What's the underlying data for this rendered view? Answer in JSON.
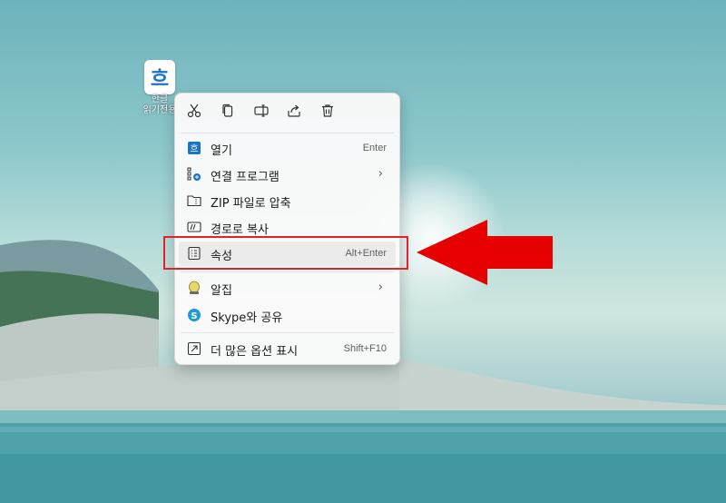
{
  "desktop": {
    "icon_label_line1": "한글",
    "icon_label_line2": "읽기전용",
    "icon_glyph": "흐",
    "icon_name": "hwp-document-icon"
  },
  "context_menu": {
    "toolbar": [
      {
        "icon": "cut-icon"
      },
      {
        "icon": "copy-icon"
      },
      {
        "icon": "rename-icon"
      },
      {
        "icon": "share-icon"
      },
      {
        "icon": "delete-icon"
      }
    ],
    "items": [
      {
        "label": "열기",
        "shortcut": "Enter",
        "icon": "hwp-app-icon"
      },
      {
        "label": "연결 프로그램",
        "submenu": true,
        "icon": "open-with-icon"
      },
      {
        "label": "ZIP 파일로 압축",
        "icon": "zip-folder-icon"
      },
      {
        "label": "경로로 복사",
        "icon": "copy-path-icon"
      },
      {
        "label": "속성",
        "shortcut": "Alt+Enter",
        "icon": "properties-icon"
      },
      {
        "label": "알집",
        "submenu": true,
        "icon": "alzip-icon"
      },
      {
        "label": "Skype와 공유",
        "icon": "skype-icon"
      },
      {
        "label": "더 많은 옵션 표시",
        "shortcut": "Shift+F10",
        "icon": "more-options-icon"
      }
    ],
    "chevron": "›"
  },
  "annotation": {
    "highlight_color": "#e2212b",
    "arrow_color": "#e60000"
  }
}
